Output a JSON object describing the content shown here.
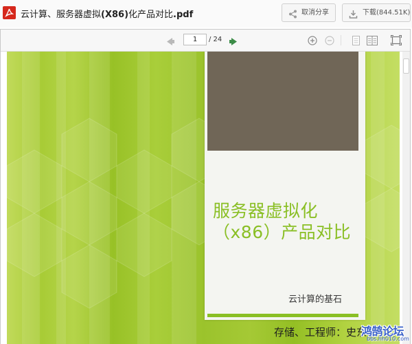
{
  "header": {
    "title_prefix": "云计算、服务器虚拟",
    "title_bold": "(X86)",
    "title_mid": "化产品对比",
    "title_ext": ".pdf",
    "share_label": "取消分享",
    "download_label": "下载(844.51K)",
    "icons": {
      "file": "pdf-icon",
      "share": "share-icon",
      "download": "download-icon"
    }
  },
  "toolbar": {
    "current_page": "1",
    "total_pages": "/ 24",
    "icons": [
      "prev-page-icon",
      "next-page-icon",
      "zoom-in-icon",
      "zoom-out-icon",
      "single-page-icon",
      "double-page-icon",
      "fullscreen-icon"
    ]
  },
  "slide": {
    "title_line1": "服务器虚拟化",
    "title_line2": "（x86）产品对比",
    "subtitle": "云计算的基石",
    "author": "存储、工程师：史东",
    "colors": {
      "accent_green": "#8abf25",
      "image_block": "#706657",
      "background_green": "#a5c935"
    }
  },
  "watermark": {
    "text": "鸿鹄论坛",
    "url": "bbs.hh010.com"
  }
}
